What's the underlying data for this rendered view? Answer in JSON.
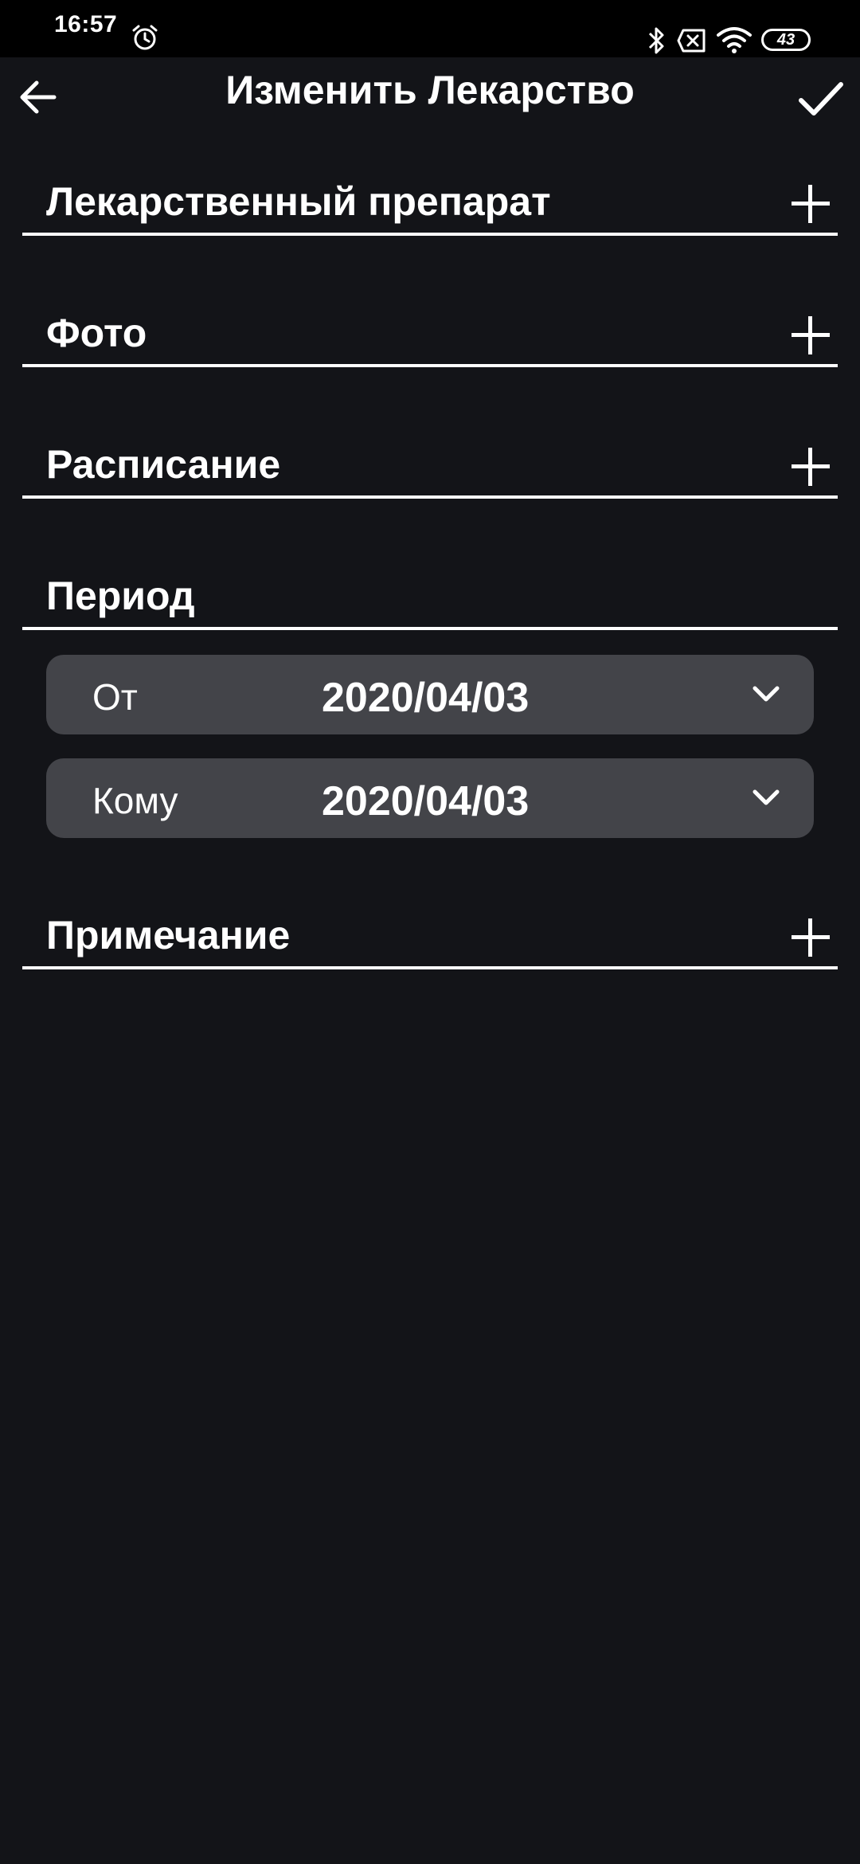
{
  "status_bar": {
    "time": "16:57",
    "battery": "43",
    "icons": [
      "alarm-icon",
      "bluetooth-icon",
      "sim-off-icon",
      "wifi-icon",
      "battery-icon"
    ]
  },
  "app_bar": {
    "title": "Изменить Лекарство",
    "back_icon": "arrow-left-icon",
    "confirm_icon": "check-icon"
  },
  "sections": {
    "drug": {
      "title": "Лекарственный препарат",
      "action_icon": "plus-icon"
    },
    "photo": {
      "title": "Фото",
      "action_icon": "plus-icon"
    },
    "schedule": {
      "title": "Расписание",
      "action_icon": "plus-icon"
    },
    "period": {
      "title": "Период",
      "from": {
        "label": "От",
        "value": "2020/04/03",
        "icon": "chevron-down-icon"
      },
      "to": {
        "label": "Кому",
        "value": "2020/04/03",
        "icon": "chevron-down-icon"
      }
    },
    "note": {
      "title": "Примечание",
      "action_icon": "plus-icon"
    }
  },
  "colors": {
    "background": "#131418",
    "status_bar": "#000000",
    "picker_background": "#434449",
    "foreground": "#ffffff"
  }
}
